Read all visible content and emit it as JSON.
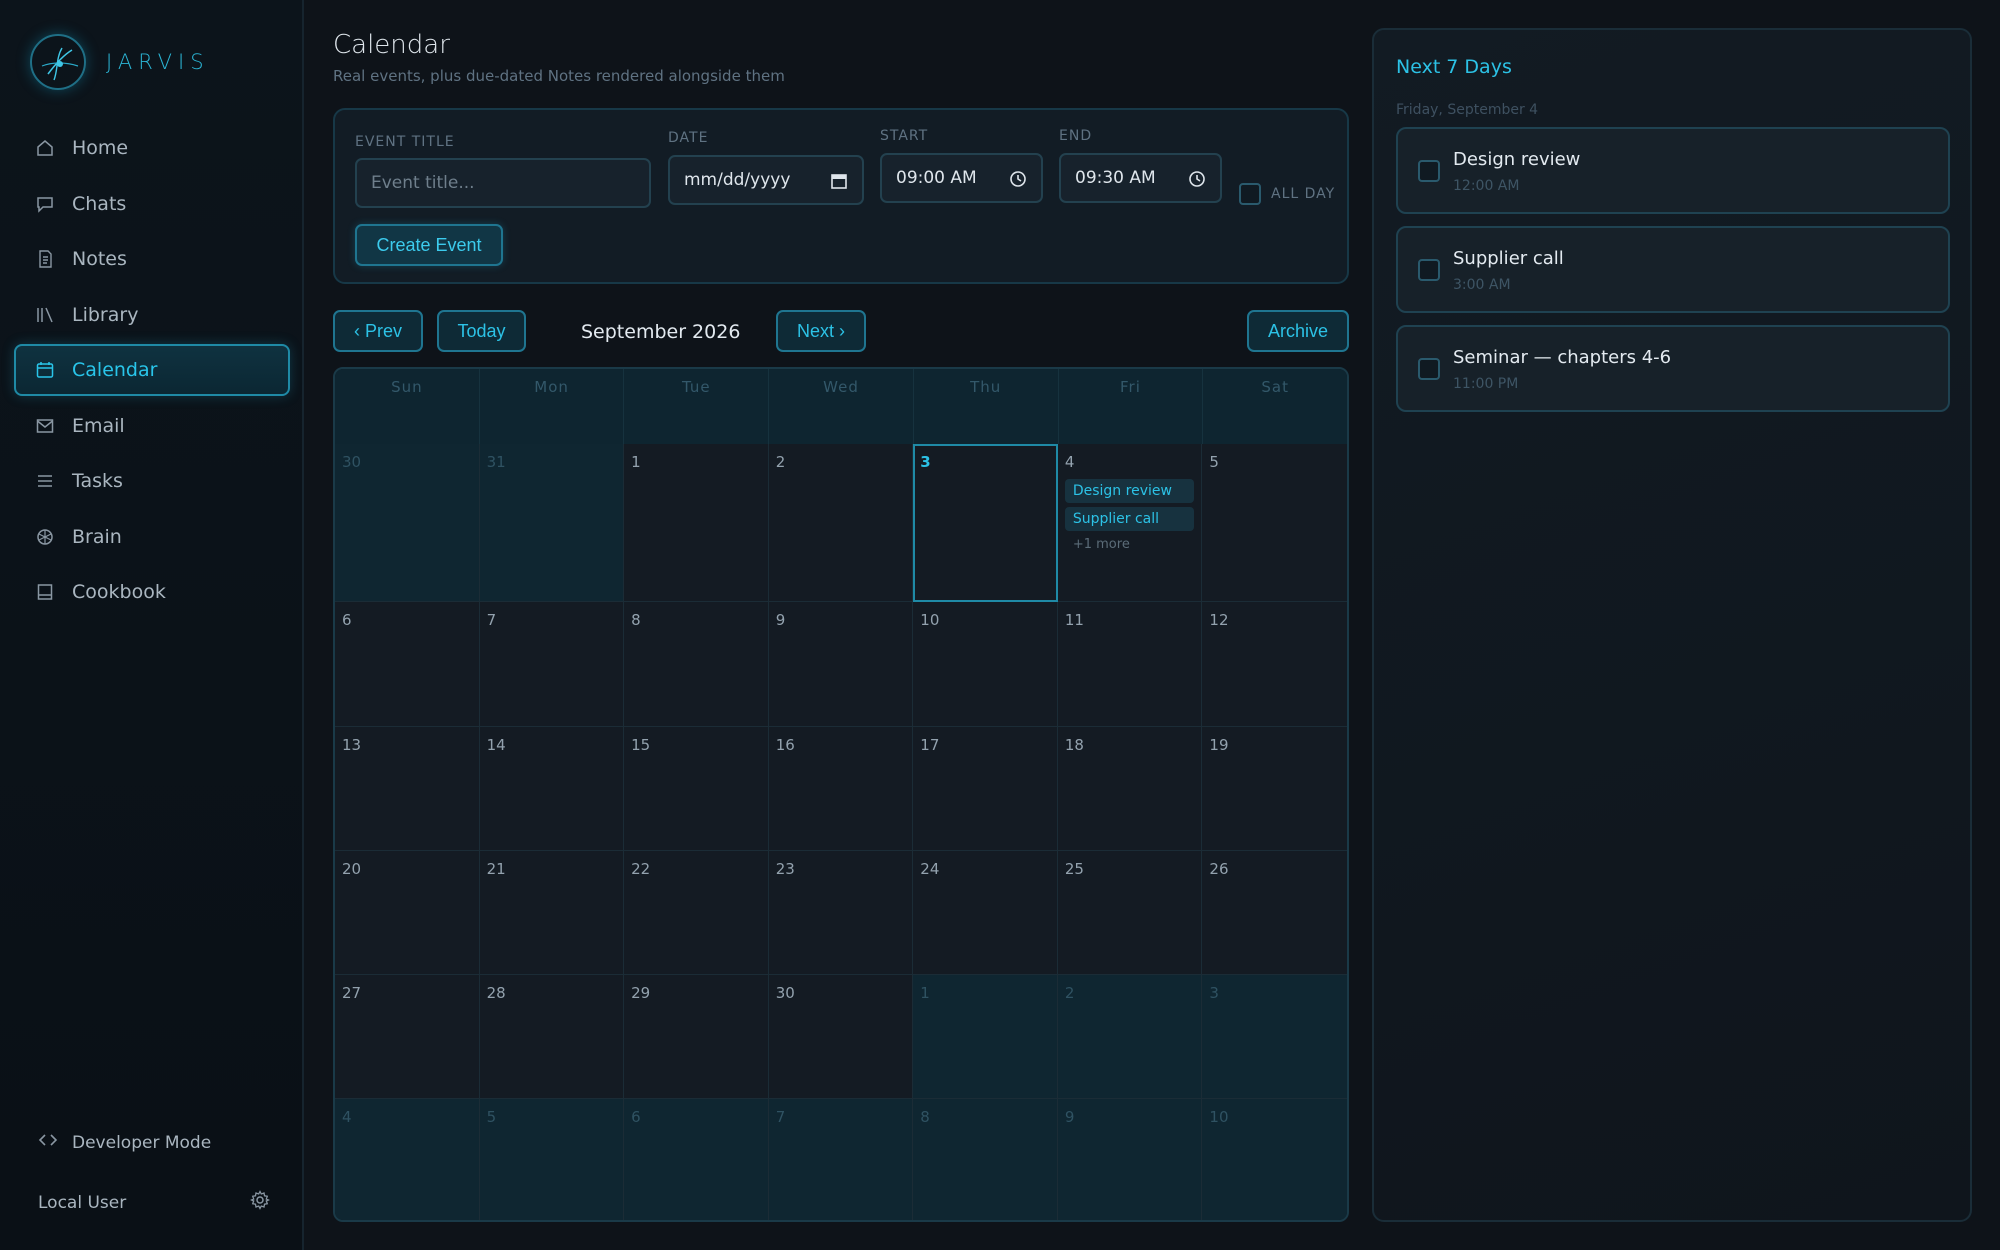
{
  "brand": {
    "name": "JARVIS"
  },
  "sidebar": {
    "items": [
      {
        "label": "Home",
        "icon": "home-icon"
      },
      {
        "label": "Chats",
        "icon": "chat-icon"
      },
      {
        "label": "Notes",
        "icon": "note-icon"
      },
      {
        "label": "Library",
        "icon": "library-icon"
      },
      {
        "label": "Calendar",
        "icon": "calendar-icon",
        "active": true
      },
      {
        "label": "Email",
        "icon": "mail-icon"
      },
      {
        "label": "Tasks",
        "icon": "list-icon"
      },
      {
        "label": "Brain",
        "icon": "brain-icon"
      },
      {
        "label": "Cookbook",
        "icon": "book-icon"
      }
    ],
    "dev_mode": "Developer Mode",
    "user": "Local User"
  },
  "page": {
    "title": "Calendar",
    "subtitle": "Real events, plus due-dated Notes rendered alongside them"
  },
  "form": {
    "title_label": "EVENT TITLE",
    "title_placeholder": "Event title...",
    "date_label": "DATE",
    "date_value": "mm/dd/yyyy",
    "start_label": "START",
    "start_value": "09:00 AM",
    "end_label": "END",
    "end_value": "09:30 AM",
    "allday_label": "ALL DAY",
    "create_label": "Create Event"
  },
  "nav": {
    "prev": "‹ Prev",
    "today": "Today",
    "month": "September 2026",
    "next": "Next ›",
    "archive": "Archive"
  },
  "calendar": {
    "weekdays": [
      "Sun",
      "Mon",
      "Tue",
      "Wed",
      "Thu",
      "Fri",
      "Sat"
    ],
    "weeks": [
      [
        {
          "d": "30",
          "other": true
        },
        {
          "d": "31",
          "other": true
        },
        {
          "d": "1"
        },
        {
          "d": "2"
        },
        {
          "d": "3",
          "today": true
        },
        {
          "d": "4",
          "events": [
            "Design review",
            "Supplier call"
          ],
          "more": "+1 more"
        },
        {
          "d": "5"
        }
      ],
      [
        {
          "d": "6"
        },
        {
          "d": "7"
        },
        {
          "d": "8"
        },
        {
          "d": "9"
        },
        {
          "d": "10"
        },
        {
          "d": "11"
        },
        {
          "d": "12"
        }
      ],
      [
        {
          "d": "13"
        },
        {
          "d": "14"
        },
        {
          "d": "15"
        },
        {
          "d": "16"
        },
        {
          "d": "17"
        },
        {
          "d": "18"
        },
        {
          "d": "19"
        }
      ],
      [
        {
          "d": "20"
        },
        {
          "d": "21"
        },
        {
          "d": "22"
        },
        {
          "d": "23"
        },
        {
          "d": "24"
        },
        {
          "d": "25"
        },
        {
          "d": "26"
        }
      ],
      [
        {
          "d": "27"
        },
        {
          "d": "28"
        },
        {
          "d": "29"
        },
        {
          "d": "30"
        },
        {
          "d": "1",
          "other": true
        },
        {
          "d": "2",
          "other": true
        },
        {
          "d": "3",
          "other": true
        }
      ],
      [
        {
          "d": "4",
          "other": true
        },
        {
          "d": "5",
          "other": true
        },
        {
          "d": "6",
          "other": true
        },
        {
          "d": "7",
          "other": true
        },
        {
          "d": "8",
          "other": true
        },
        {
          "d": "9",
          "other": true
        },
        {
          "d": "10",
          "other": true
        }
      ]
    ]
  },
  "agenda": {
    "title": "Next 7 Days",
    "date": "Friday, September 4",
    "items": [
      {
        "title": "Design review",
        "time": "12:00 AM"
      },
      {
        "title": "Supplier call",
        "time": "3:00 AM"
      },
      {
        "title": "Seminar — chapters 4-6",
        "time": "11:00 PM"
      }
    ]
  },
  "colors": {
    "accent": "#2cc2e6",
    "background": "#0e1319",
    "panel": "#121c25"
  }
}
